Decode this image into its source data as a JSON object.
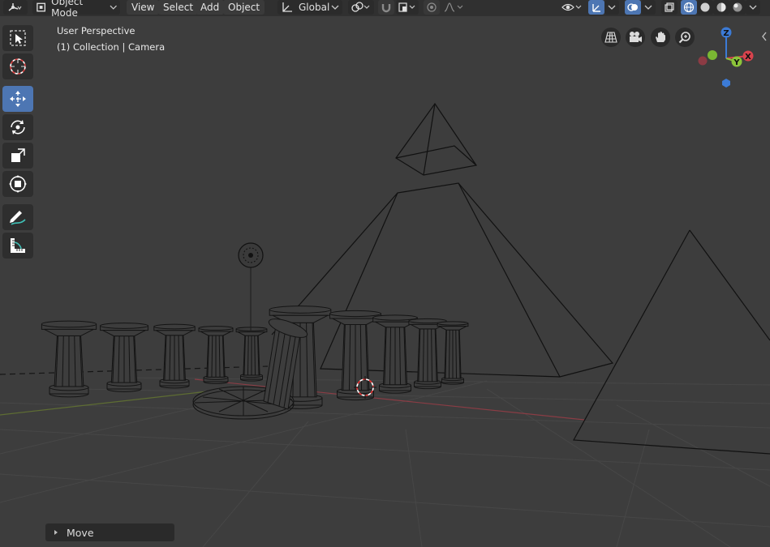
{
  "header": {
    "mode_label": "Object Mode",
    "menus": [
      "View",
      "Select",
      "Add",
      "Object"
    ],
    "orientation_label": "Global"
  },
  "viewport": {
    "perspective_label": "User Perspective",
    "context_label": "(1) Collection | Camera"
  },
  "gizmo": {
    "z_label": "Z",
    "y_label": "Y",
    "x_label": "X"
  },
  "last_operator": {
    "label": "Move",
    "collapsed": true
  },
  "toolbar": {
    "tools": [
      "select-box",
      "cursor",
      "move",
      "rotate",
      "scale",
      "transform",
      "annotate",
      "measure"
    ],
    "active_tool": "move"
  },
  "colors": {
    "accent": "#4d76b3",
    "background": "#3d3d3d",
    "header": "#303030",
    "axis_x": "#d8434d",
    "axis_y": "#8cc43a",
    "axis_z": "#3c7bd6"
  }
}
